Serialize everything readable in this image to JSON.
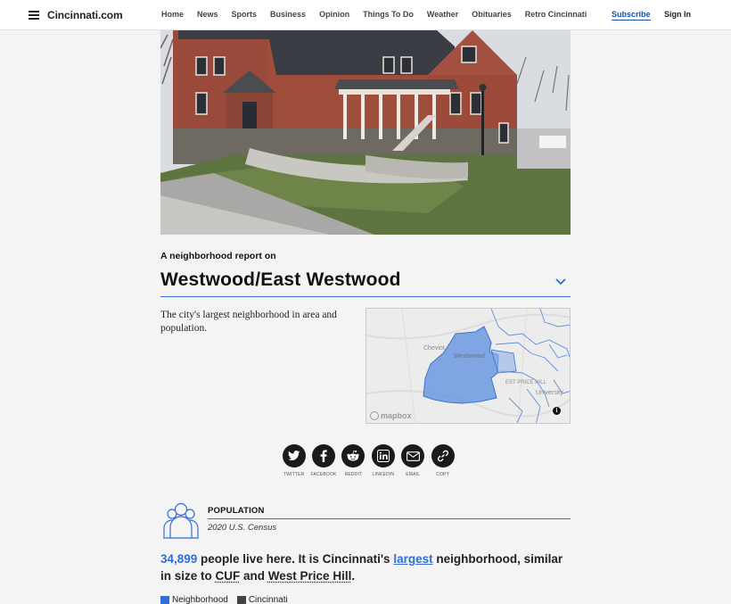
{
  "nav": {
    "logo": "Cincinnati.com",
    "links": [
      "Home",
      "News",
      "Sports",
      "Business",
      "Opinion",
      "Things To Do",
      "Weather",
      "Obituaries",
      "Retro Cincinnati"
    ],
    "subscribe": "Subscribe",
    "signin": "Sign In"
  },
  "report": {
    "kicker": "A neighborhood report on",
    "title": "Westwood/East Westwood",
    "description": "The city's largest neighborhood in area and population."
  },
  "map": {
    "labels": [
      "Cheviot",
      "Westwood",
      "EST PRICE HILL",
      "University"
    ],
    "attribution": "mapbox",
    "info": "i"
  },
  "share": [
    {
      "label": "TWITTER",
      "icon": "twitter-icon"
    },
    {
      "label": "FACEBOOK",
      "icon": "facebook-icon"
    },
    {
      "label": "REDDIT",
      "icon": "reddit-icon"
    },
    {
      "label": "LINKEDIN",
      "icon": "linkedin-icon"
    },
    {
      "label": "EMAIL",
      "icon": "email-icon"
    },
    {
      "label": "COPY",
      "icon": "link-icon"
    }
  ],
  "population": {
    "heading": "POPULATION",
    "source": "2020 U.S. Census",
    "count": "34,899",
    "text_1": " people live here. It is Cincinnati's ",
    "rank": "largest",
    "text_2": " neighborhood, similar in size to ",
    "peer_1": "CUF",
    "text_3": " and ",
    "peer_2": "West Price Hill",
    "text_4": "."
  },
  "legend": [
    {
      "label": "Neighborhood",
      "color": "#2f6fd6"
    },
    {
      "label": "Cincinnati",
      "color": "#444444"
    }
  ],
  "colors": {
    "accent": "#2f6fd6",
    "link": "#1a4ea8"
  }
}
